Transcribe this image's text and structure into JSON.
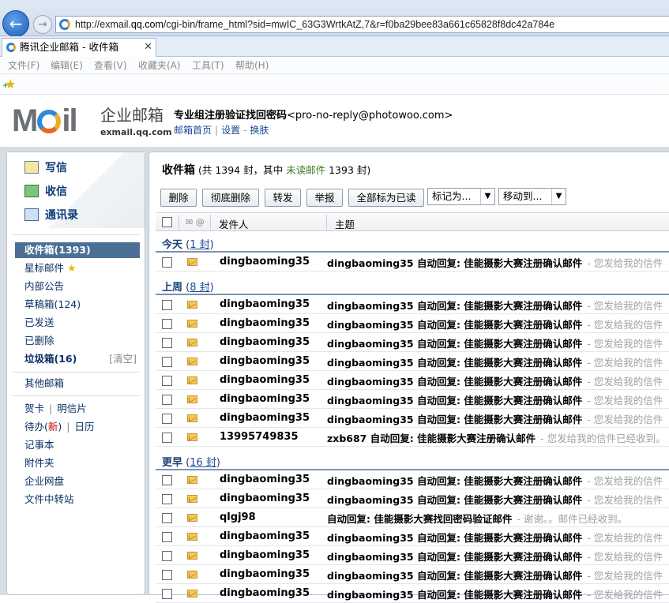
{
  "browser": {
    "url_prefix": "http://exmail.",
    "url_host": "qq.com",
    "url_rest": "/cgi-bin/frame_html?sid=mwIC_63G3WrtkAtZ,7&r=f0ba29bee83a661c65828f8dc42a784e",
    "back_label": "←",
    "forward_label": "→",
    "tab_title": "腾讯企业邮箱 - 收件箱",
    "tab_close": "✕",
    "menu": [
      "文件(F)",
      "编辑(E)",
      "查看(V)",
      "收藏夹(A)",
      "工具(T)",
      "帮助(H)"
    ],
    "fav_star": "★",
    "fav_plus": "+"
  },
  "header": {
    "logo_word_left": "M",
    "logo_word_right": "il",
    "logo_cn": "企业邮箱",
    "logo_sub": "exmail.qq.com",
    "account_name": "专业组注册验证找回密码",
    "account_email": "<pro-no-reply@photowoo.com>",
    "links": [
      "邮箱首页",
      "设置",
      "换肤"
    ],
    "link_sep": "|",
    "link_dash": "-"
  },
  "sidebar": {
    "quick": [
      "写信",
      "收信",
      "通讯录"
    ],
    "folders": [
      {
        "label": "收件箱(1393)"
      },
      {
        "label": "星标邮件 ",
        "star": "★"
      },
      {
        "label": "内部公告"
      },
      {
        "label": "草稿箱(124)"
      },
      {
        "label": "已发送"
      },
      {
        "label": "已删除"
      },
      {
        "label": "垃圾箱(16)",
        "aside": "[清空]"
      },
      {
        "label": "其他邮箱"
      }
    ],
    "tools": {
      "card": "贺卡",
      "postcard": "明信片",
      "todo_prefix": "待办(",
      "todo_new": "新",
      "todo_suffix": ")",
      "calendar": "日历",
      "sep": "|",
      "notebook": "记事本",
      "attachments": "附件夹",
      "netdisk": "企业网盘",
      "transfer": "文件中转站"
    }
  },
  "main": {
    "title": "收件箱",
    "summary_a": " (共 1394 封，其中 ",
    "unread_label": "未读邮件",
    "summary_b": " 1393 封)",
    "buttons": [
      "删除",
      "彻底删除",
      "转发",
      "举报",
      "全部标为已读"
    ],
    "mark_select": "标记为...",
    "move_select": "移动到...",
    "select_arrow": "▼",
    "head_icons": "✉ @",
    "col_sender": "发件人",
    "col_subject": "主题",
    "groups": [
      {
        "name": "今天",
        "count": "1 封",
        "open": " (",
        "close": ")"
      },
      {
        "name": "上周",
        "count": "8 封",
        "open": " (",
        "close": ")"
      },
      {
        "name": "更早",
        "count": "16 封",
        "open": " (",
        "close": ")"
      }
    ],
    "rows_today": [
      {
        "sender": "dingbaoming35",
        "subject": "dingbaoming35 自动回复: 佳能摄影大赛注册确认邮件",
        "snippet": "- 您发给我的信件"
      }
    ],
    "rows_week": [
      {
        "sender": "dingbaoming35",
        "subject": "dingbaoming35 自动回复: 佳能摄影大赛注册确认邮件",
        "snippet": "- 您发给我的信件"
      },
      {
        "sender": "dingbaoming35",
        "subject": "dingbaoming35 自动回复: 佳能摄影大赛注册确认邮件",
        "snippet": "- 您发给我的信件"
      },
      {
        "sender": "dingbaoming35",
        "subject": "dingbaoming35 自动回复: 佳能摄影大赛注册确认邮件",
        "snippet": "- 您发给我的信件"
      },
      {
        "sender": "dingbaoming35",
        "subject": "dingbaoming35 自动回复: 佳能摄影大赛注册确认邮件",
        "snippet": "- 您发给我的信件"
      },
      {
        "sender": "dingbaoming35",
        "subject": "dingbaoming35 自动回复: 佳能摄影大赛注册确认邮件",
        "snippet": "- 您发给我的信件"
      },
      {
        "sender": "dingbaoming35",
        "subject": "dingbaoming35 自动回复: 佳能摄影大赛注册确认邮件",
        "snippet": "- 您发给我的信件"
      },
      {
        "sender": "dingbaoming35",
        "subject": "dingbaoming35 自动回复: 佳能摄影大赛注册确认邮件",
        "snippet": "- 您发给我的信件"
      },
      {
        "sender": "13995749835",
        "subject": "zxb687 自动回复: 佳能摄影大赛注册确认邮件",
        "snippet": "- 您发给我的信件已经收到。"
      }
    ],
    "rows_earlier": [
      {
        "sender": "dingbaoming35",
        "subject": "dingbaoming35 自动回复: 佳能摄影大赛注册确认邮件",
        "snippet": "- 您发给我的信件"
      },
      {
        "sender": "dingbaoming35",
        "subject": "dingbaoming35 自动回复: 佳能摄影大赛注册确认邮件",
        "snippet": "- 您发给我的信件"
      },
      {
        "sender": "qlgj98",
        "subject": "自动回复: 佳能摄影大赛找回密码验证邮件",
        "snippet": "- 谢谢。。邮件已经收到。"
      },
      {
        "sender": "dingbaoming35",
        "subject": "dingbaoming35 自动回复: 佳能摄影大赛注册确认邮件",
        "snippet": "- 您发给我的信件"
      },
      {
        "sender": "dingbaoming35",
        "subject": "dingbaoming35 自动回复: 佳能摄影大赛注册确认邮件",
        "snippet": "- 您发给我的信件"
      },
      {
        "sender": "dingbaoming35",
        "subject": "dingbaoming35 自动回复: 佳能摄影大赛注册确认邮件",
        "snippet": "- 您发给我的信件"
      },
      {
        "sender": "dingbaoming35",
        "subject": "dingbaoming35 自动回复: 佳能摄影大赛注册确认邮件",
        "snippet": "- 您发给我的信件"
      }
    ]
  }
}
